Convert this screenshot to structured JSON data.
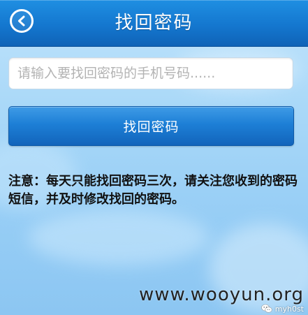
{
  "header": {
    "title": "找回密码",
    "back_icon": "back-arrow-icon",
    "color": "#1477cf"
  },
  "form": {
    "phone_placeholder": "请输入要找回密码的手机号码......",
    "phone_value": "",
    "submit_label": "找回密码"
  },
  "notice": {
    "text": "注意：每天只能找回密码三次，请关注您收到的密码短信，并及时修改找回的密码。"
  },
  "watermark": {
    "site": "www.wooyun.org",
    "handle": "myh0st",
    "icon": "wechat-icon"
  }
}
